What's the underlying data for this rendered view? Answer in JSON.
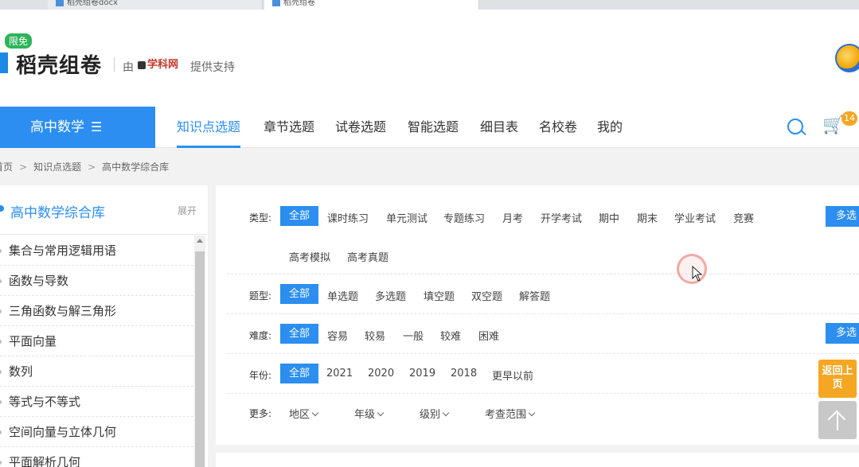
{
  "browser": {
    "tabs": [
      {
        "label": "稻壳组卷docx"
      },
      {
        "label": "稻壳组卷"
      }
    ]
  },
  "header": {
    "badge": "限免",
    "logo_text": "稻壳组卷",
    "by_label": "由",
    "partner_logo": "学科网",
    "support_label": "提供支持"
  },
  "nav": {
    "subject": "高中数学",
    "items": [
      {
        "label": "知识点选题",
        "active": true
      },
      {
        "label": "章节选题"
      },
      {
        "label": "试卷选题"
      },
      {
        "label": "智能选题"
      },
      {
        "label": "细目表"
      },
      {
        "label": "名校卷"
      },
      {
        "label": "我的"
      }
    ],
    "cart_count": "14"
  },
  "breadcrumb": [
    "首页",
    "知识点选题",
    "高中数学综合库"
  ],
  "sidebar": {
    "title": "高中数学综合库",
    "expand_label": "展开",
    "items": [
      "集合与常用逻辑用语",
      "函数与导数",
      "三角函数与解三角形",
      "平面向量",
      "数列",
      "等式与不等式",
      "空间向量与立体几何",
      "平面解析几何"
    ]
  },
  "filters": {
    "type": {
      "label": "类型:",
      "options": [
        "全部",
        "课时练习",
        "单元测试",
        "专题练习",
        "月考",
        "开学考试",
        "期中",
        "期末",
        "学业考试",
        "竞赛",
        "高考模拟",
        "高考真题"
      ],
      "multi_label": "多选"
    },
    "question_type": {
      "label": "题型:",
      "options": [
        "全部",
        "单选题",
        "多选题",
        "填空题",
        "双空题",
        "解答题"
      ]
    },
    "difficulty": {
      "label": "难度:",
      "options": [
        "全部",
        "容易",
        "较易",
        "一般",
        "较难",
        "困难"
      ],
      "multi_label": "多选"
    },
    "year": {
      "label": "年份:",
      "options": [
        "全部",
        "2021",
        "2020",
        "2019",
        "2018",
        "更早以前"
      ]
    },
    "more": {
      "label": "更多:",
      "dropdowns": [
        "地区",
        "年级",
        "级别",
        "考查范围"
      ]
    }
  },
  "float": {
    "back_label": "返回上页"
  },
  "colors": {
    "accent": "#2b8ef0",
    "badge": "#2db45a",
    "orange": "#f5a623"
  }
}
